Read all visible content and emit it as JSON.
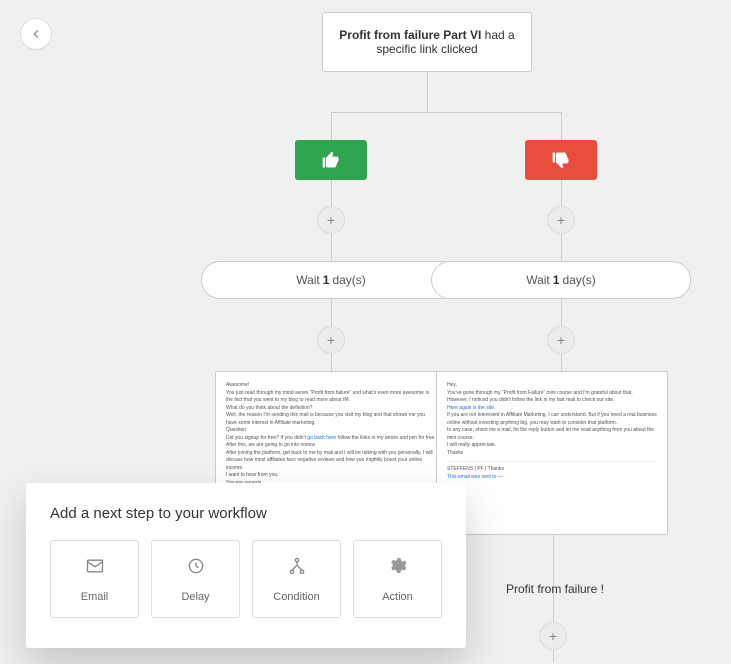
{
  "back": {
    "glyph": "←"
  },
  "condition": {
    "title_bold": "Profit from failure Part VI",
    "suffix": " had a specific link clicked"
  },
  "branches": {
    "yes": {
      "wait_prefix": "Wait ",
      "wait_value": "1",
      "wait_suffix": " day(s)",
      "email": {
        "line1": "Awesome!",
        "line2": "You just read through my mind series “Profit from failure” and what's even more awesome is the fact that you went to my blog to read more about IM.",
        "line3": "What do you think about the definition?",
        "line4": "Well, the reason I'm sending this mail is because you visit my blog and that shows me you have some interest in Affiliate marketing.",
        "line5": "Question",
        "line6a": "Did you signup for free? If you didn't ",
        "link": "go back here",
        "line6b": " follow the links in my article and join for free.",
        "line7": "After this, we are going to go into review.",
        "line8": "After joining the platform, get back to me by mail and I will be talking with you personally. I will discuss how most affiliates face negative reviews and how you mightily boost your online income.",
        "line9": "I want to hear from you.",
        "line10": "Sincere regards"
      }
    },
    "no": {
      "wait_prefix": "Wait ",
      "wait_value": "1",
      "wait_suffix": " day(s)",
      "email": {
        "line1": "Hey,",
        "line2": "You've gone through my “Profit from Failure” mini course and I'm grateful about that.",
        "line3": "However, I noticed you didn't follow the link in my last mail to check our site.",
        "link": "Here again is the site.",
        "line4": "If you are not interested in Affiliate Marketing, I can understand. But if you need a real business online without investing anything big, you may want to consider that platform.",
        "line5": "In any case, shoot me a mail, hit the reply button and let me read anything from you about the mini course.",
        "line6": "I will really appreciate.",
        "line7": "Thanks",
        "footer": "STEFFENS | PF | Thanks",
        "footer2": "This email was sent to —"
      },
      "title": "Profit from failure !"
    }
  },
  "modal": {
    "title": "Add a next step to your workflow",
    "options": {
      "email": "Email",
      "delay": "Delay",
      "condition": "Condition",
      "action": "Action"
    }
  }
}
